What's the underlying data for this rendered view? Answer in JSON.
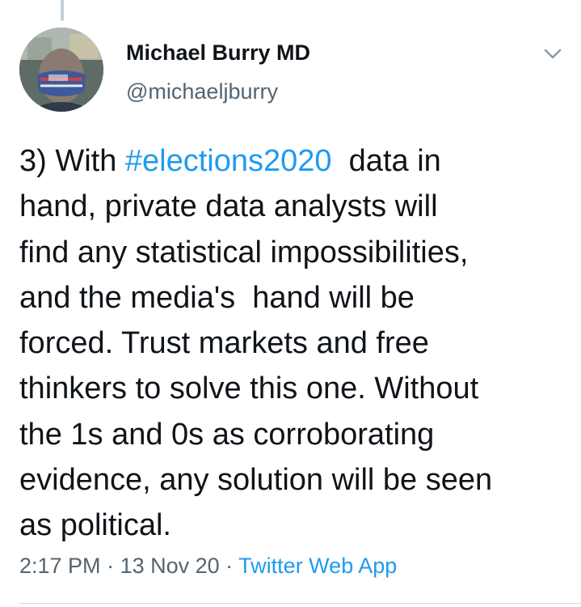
{
  "user": {
    "display_name": "Michael Burry MD",
    "handle": "@michaeljburry"
  },
  "tweet": {
    "prefix": "3) With ",
    "hashtag": "#elections2020",
    "body": "  data in\nhand, private data analysts will\nfind any statistical impossibilities,\nand the media's  hand will be\nforced. Trust markets and free\nthinkers to solve this one. Without\nthe 1s and 0s as corroborating\nevidence, any solution will be seen\nas political."
  },
  "meta": {
    "time": "2:17 PM",
    "separator1": " · ",
    "date": "13 Nov 20",
    "separator2": " · ",
    "source": "Twitter Web App"
  },
  "icons": {
    "more": "chevron-down-icon"
  },
  "colors": {
    "link": "#1d9bf0",
    "secondary_text": "#536471",
    "primary_text": "#0f1419"
  }
}
